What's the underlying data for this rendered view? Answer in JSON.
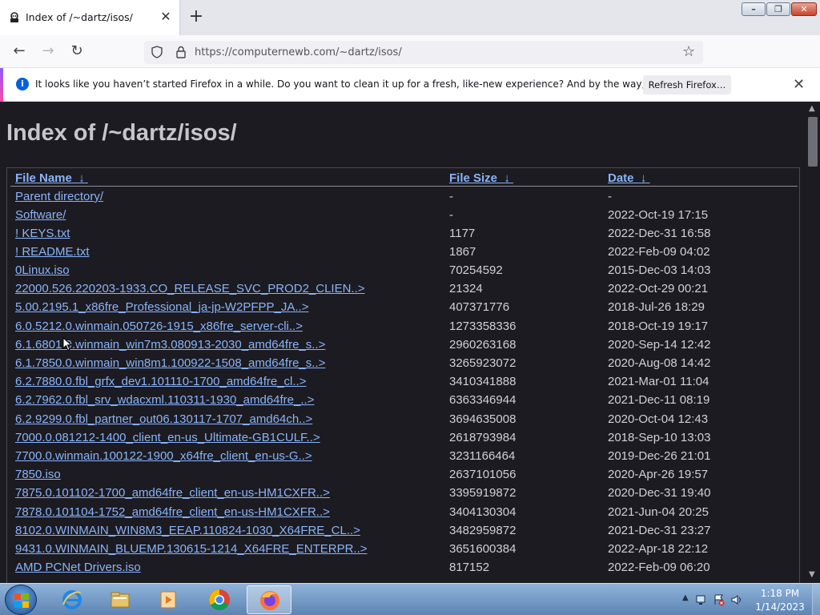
{
  "browser": {
    "tab_title": "Index of /~dartz/isos/",
    "url": "https://computernewb.com/~dartz/isos/",
    "colors": {
      "accent": "#9059ff",
      "link": "#8ab4f8"
    }
  },
  "infobar": {
    "message": "It looks like you haven’t started Firefox in a while. Do you want to clean it up for a fresh, like-new experience? And by the way, welcome back!",
    "button_label": "Refresh Firefox…"
  },
  "page": {
    "title": "Index of /~dartz/isos/",
    "headers": {
      "name": "File Name",
      "size": "File Size",
      "date": "Date",
      "sort_arrow": "↓"
    },
    "rows": [
      {
        "name": "Parent directory/",
        "size": "-",
        "date": "-"
      },
      {
        "name": "Software/",
        "size": "-",
        "date": "2022-Oct-19 17:15"
      },
      {
        "name": "! KEYS.txt",
        "size": "1177",
        "date": "2022-Dec-31 16:58"
      },
      {
        "name": "! README.txt",
        "size": "1867",
        "date": "2022-Feb-09 04:02"
      },
      {
        "name": "0Linux.iso",
        "size": "70254592",
        "date": "2015-Dec-03 14:03"
      },
      {
        "name": "22000.526.220203-1933.CO_RELEASE_SVC_PROD2_CLIEN..>",
        "size": "21324",
        "date": "2022-Oct-29 00:21"
      },
      {
        "name": "5.00.2195.1_x86fre_Professional_ja-jp-W2PFPP_JA..>",
        "size": "407371776",
        "date": "2018-Jul-26 18:29"
      },
      {
        "name": "6.0.5212.0.winmain.050726-1915_x86fre_server-cli..>",
        "size": "1273358336",
        "date": "2018-Oct-19 19:17"
      },
      {
        "name": "6.1.6801.0.winmain_win7m3.080913-2030_amd64fre_s..>",
        "size": "2960263168",
        "date": "2020-Sep-14 12:42"
      },
      {
        "name": "6.1.7850.0.winmain_win8m1.100922-1508_amd64fre_s..>",
        "size": "3265923072",
        "date": "2020-Aug-08 14:42"
      },
      {
        "name": "6.2.7880.0.fbl_grfx_dev1.101110-1700_amd64fre_cl..>",
        "size": "3410341888",
        "date": "2021-Mar-01 11:04"
      },
      {
        "name": "6.2.7962.0.fbl_srv_wdacxml.110311-1930_amd64fre_..>",
        "size": "6363346944",
        "date": "2021-Dec-11 08:19"
      },
      {
        "name": "6.2.9299.0.fbl_partner_out06.130117-1707_amd64ch..>",
        "size": "3694635008",
        "date": "2020-Oct-04 12:43"
      },
      {
        "name": "7000.0.081212-1400_client_en-us_Ultimate-GB1CULF..>",
        "size": "2618793984",
        "date": "2018-Sep-10 13:03"
      },
      {
        "name": "7700.0.winmain.100122-1900_x64fre_client_en-us-G..>",
        "size": "3231166464",
        "date": "2019-Dec-26 21:01"
      },
      {
        "name": "7850.iso",
        "size": "2637101056",
        "date": "2020-Apr-26 19:57"
      },
      {
        "name": "7875.0.101102-1700_amd64fre_client_en-us-HM1CXFR..>",
        "size": "3395919872",
        "date": "2020-Dec-31 19:40"
      },
      {
        "name": "7878.0.101104-1752_amd64fre_client_en-us-HM1CXFR..>",
        "size": "3404130304",
        "date": "2021-Jun-04 20:25"
      },
      {
        "name": "8102.0.WINMAIN_WIN8M3_EEAP.110824-1030_X64FRE_CL..>",
        "size": "3482959872",
        "date": "2021-Dec-31 23:27"
      },
      {
        "name": "9431.0.WINMAIN_BLUEMP.130615-1214_X64FRE_ENTERPR..>",
        "size": "3651600384",
        "date": "2022-Apr-18 22:12"
      },
      {
        "name": "AMD PCNet Drivers.iso",
        "size": "817152",
        "date": "2022-Feb-09 06:20"
      }
    ]
  },
  "taskbar": {
    "apps": [
      "internet-explorer-icon",
      "file-explorer-icon",
      "media-player-icon",
      "chrome-icon",
      "firefox-icon"
    ],
    "time": "1:18 PM",
    "date": "1/14/2023"
  }
}
